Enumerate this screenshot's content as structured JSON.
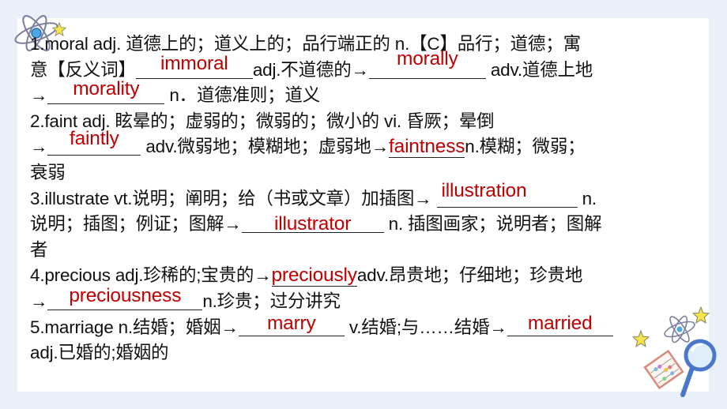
{
  "slide": {
    "entries": [
      {
        "lines": [
          {
            "pre": "1.moral adj. 道德上的；道义上的；品行端正的 n.【C】品行；道德；寓"
          },
          {
            "pre": "意【反义词】",
            "answer1": "immoral",
            "mid": "adj.不道德的→",
            "answer2": "morally",
            "post": " adv.道德上地"
          },
          {
            "pre": "→",
            "answer1": "morality",
            "post": " n．道德准则；道义"
          }
        ]
      },
      {
        "lines": [
          {
            "pre": "2.faint adj. 眩晕的；虚弱的；微弱的；微小的 vi. 昏厥；晕倒"
          },
          {
            "pre": "→",
            "answer1": "faintly",
            "mid": " adv.微弱地；模糊地；虚弱地→",
            "answer2": "faintness",
            "post": "n.模糊；微弱；"
          },
          {
            "pre": "衰弱"
          }
        ]
      },
      {
        "lines": [
          {
            "pre": "3.illustrate vt.说明；阐明；给（书或文章）加插图→ ",
            "answer1": "illustration",
            "post": " n."
          },
          {
            "pre": "说明；插图；例证；图解→",
            "answer1": "illustrator",
            "post": " n. 插图画家；说明者；图解"
          },
          {
            "pre": "者"
          }
        ]
      },
      {
        "lines": [
          {
            "pre": "4.precious adj.珍稀的;宝贵的→",
            "answer1": "preciously",
            "post": "adv.昂贵地；仔细地；珍贵地"
          },
          {
            "pre": "→",
            "answer1": "preciousness",
            "post": "n.珍贵；过分讲究"
          }
        ]
      },
      {
        "lines": [
          {
            "pre": "5.marriage n.结婚；婚姻→",
            "answer1": "marry",
            "mid": " v.结婚;与……结婚→",
            "answer2": "married"
          },
          {
            "pre": "adj.已婚的;婚姻的"
          }
        ]
      }
    ]
  },
  "decorations": {
    "top_left": [
      "atom-icon",
      "star-icon"
    ],
    "bottom_right": [
      "star-icon",
      "atom-icon",
      "star-icon",
      "abacus-icon",
      "magnifier-icon"
    ]
  },
  "colors": {
    "background": "#e9f0f8",
    "card": "#ffffff",
    "text": "#111111",
    "answer": "#c00000"
  }
}
